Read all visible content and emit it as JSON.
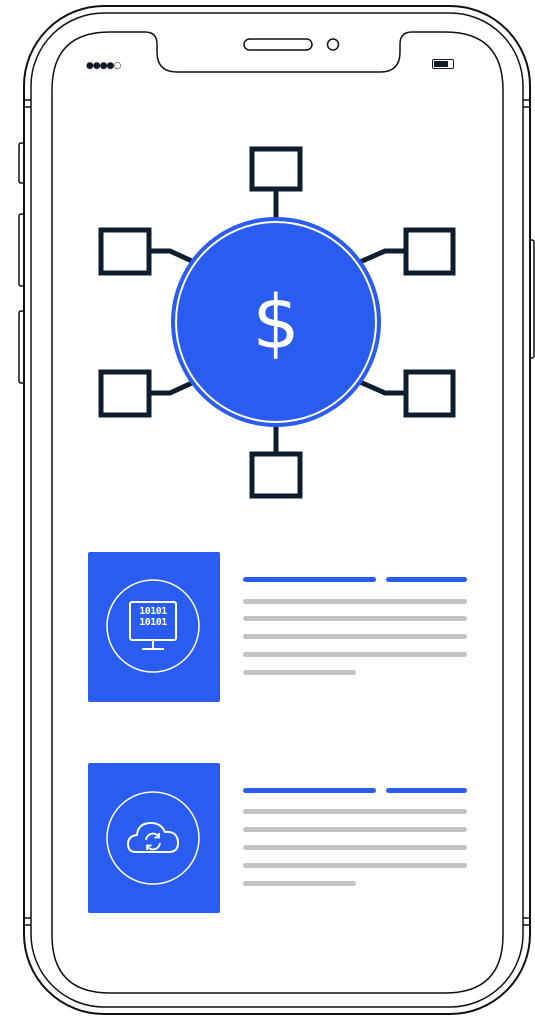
{
  "status_bar": {
    "signal": "●●●●○",
    "battery_level": 0.85
  },
  "hero": {
    "symbol": "$",
    "icon": "dollar-network-icon",
    "node_count": 6
  },
  "features": [
    {
      "icon": "binary-monitor-icon",
      "icon_text": [
        "10101",
        "10101"
      ]
    },
    {
      "icon": "cloud-sync-icon"
    }
  ],
  "colors": {
    "accent": "#2b5cf0",
    "outline": "#0f1e2e",
    "placeholder_line": "#c3c3c3"
  }
}
